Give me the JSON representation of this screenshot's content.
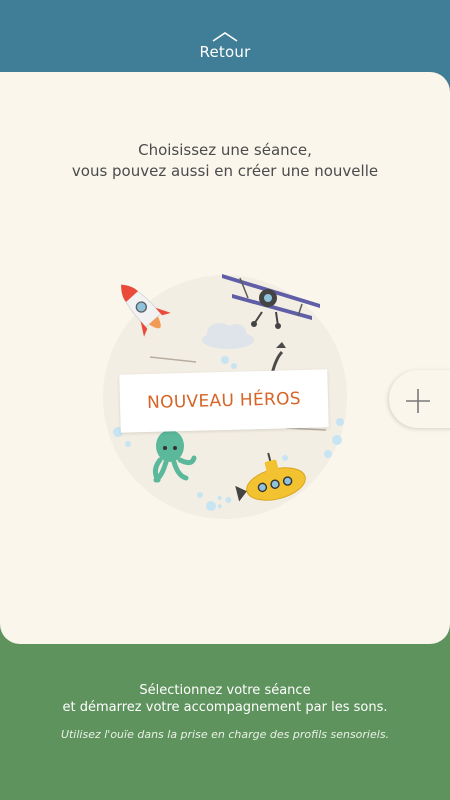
{
  "header": {
    "back_label": "Retour"
  },
  "intro": {
    "line1": "Choisissez une séance,",
    "line2": "vous pouvez aussi en créer une nouvelle"
  },
  "session": {
    "title": "NOUVEAU HÉROS"
  },
  "footer": {
    "line1": "Sélectionnez votre séance",
    "line2": "et démarrez votre accompagnement par les sons.",
    "note": "Utilisez l'ouïe dans la prise en charge des profils sensoriels."
  },
  "icons": [
    "chevron-up-icon",
    "plus-icon",
    "rocket-icon",
    "biplane-icon",
    "cloud-icon",
    "octopus-icon",
    "submarine-icon"
  ],
  "colors": {
    "header": "#3f7e96",
    "card": "#faf6ec",
    "footer": "#5f935e",
    "accent": "#d66427"
  }
}
